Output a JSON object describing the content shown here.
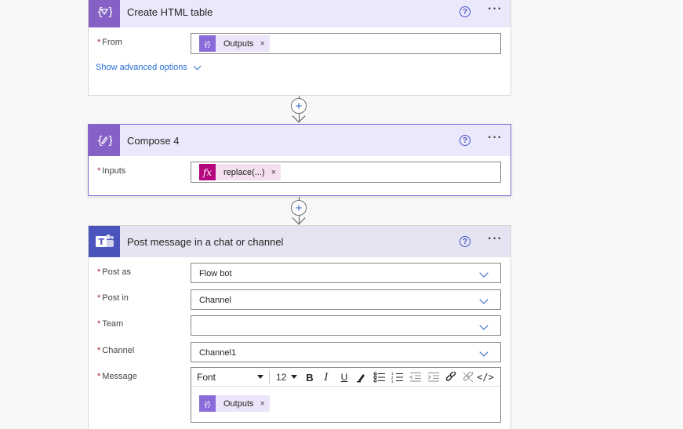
{
  "cards": {
    "html_table": {
      "title": "Create HTML table",
      "from_label": "From",
      "from_token": "Outputs",
      "advanced": "Show advanced options"
    },
    "compose": {
      "title": "Compose 4",
      "inputs_label": "Inputs",
      "inputs_token": "replace(...)"
    },
    "teams": {
      "title": "Post message in a chat or channel",
      "post_as_label": "Post as",
      "post_as_value": "Flow bot",
      "post_in_label": "Post in",
      "post_in_value": "Channel",
      "team_label": "Team",
      "team_value": "",
      "channel_label": "Channel",
      "channel_value": "Channel1",
      "message_label": "Message",
      "font_label": "Font",
      "font_size": "12",
      "message_token": "Outputs"
    }
  },
  "common": {
    "required_mark": "*",
    "help_glyph": "?",
    "more_glyph": "···",
    "remove_glyph": "×",
    "plus_glyph": "+"
  },
  "colors": {
    "accent_purple": "#8561c5",
    "teams_purple": "#4b53bc",
    "link_blue": "#2b6fd6",
    "required_red": "#a4262c",
    "expression_magenta": "#b4077f"
  },
  "icons": [
    "data-operation-icon",
    "compose-icon",
    "teams-icon",
    "help-icon",
    "more-options-icon",
    "remove-token-icon",
    "add-step-icon",
    "expression-icon"
  ]
}
